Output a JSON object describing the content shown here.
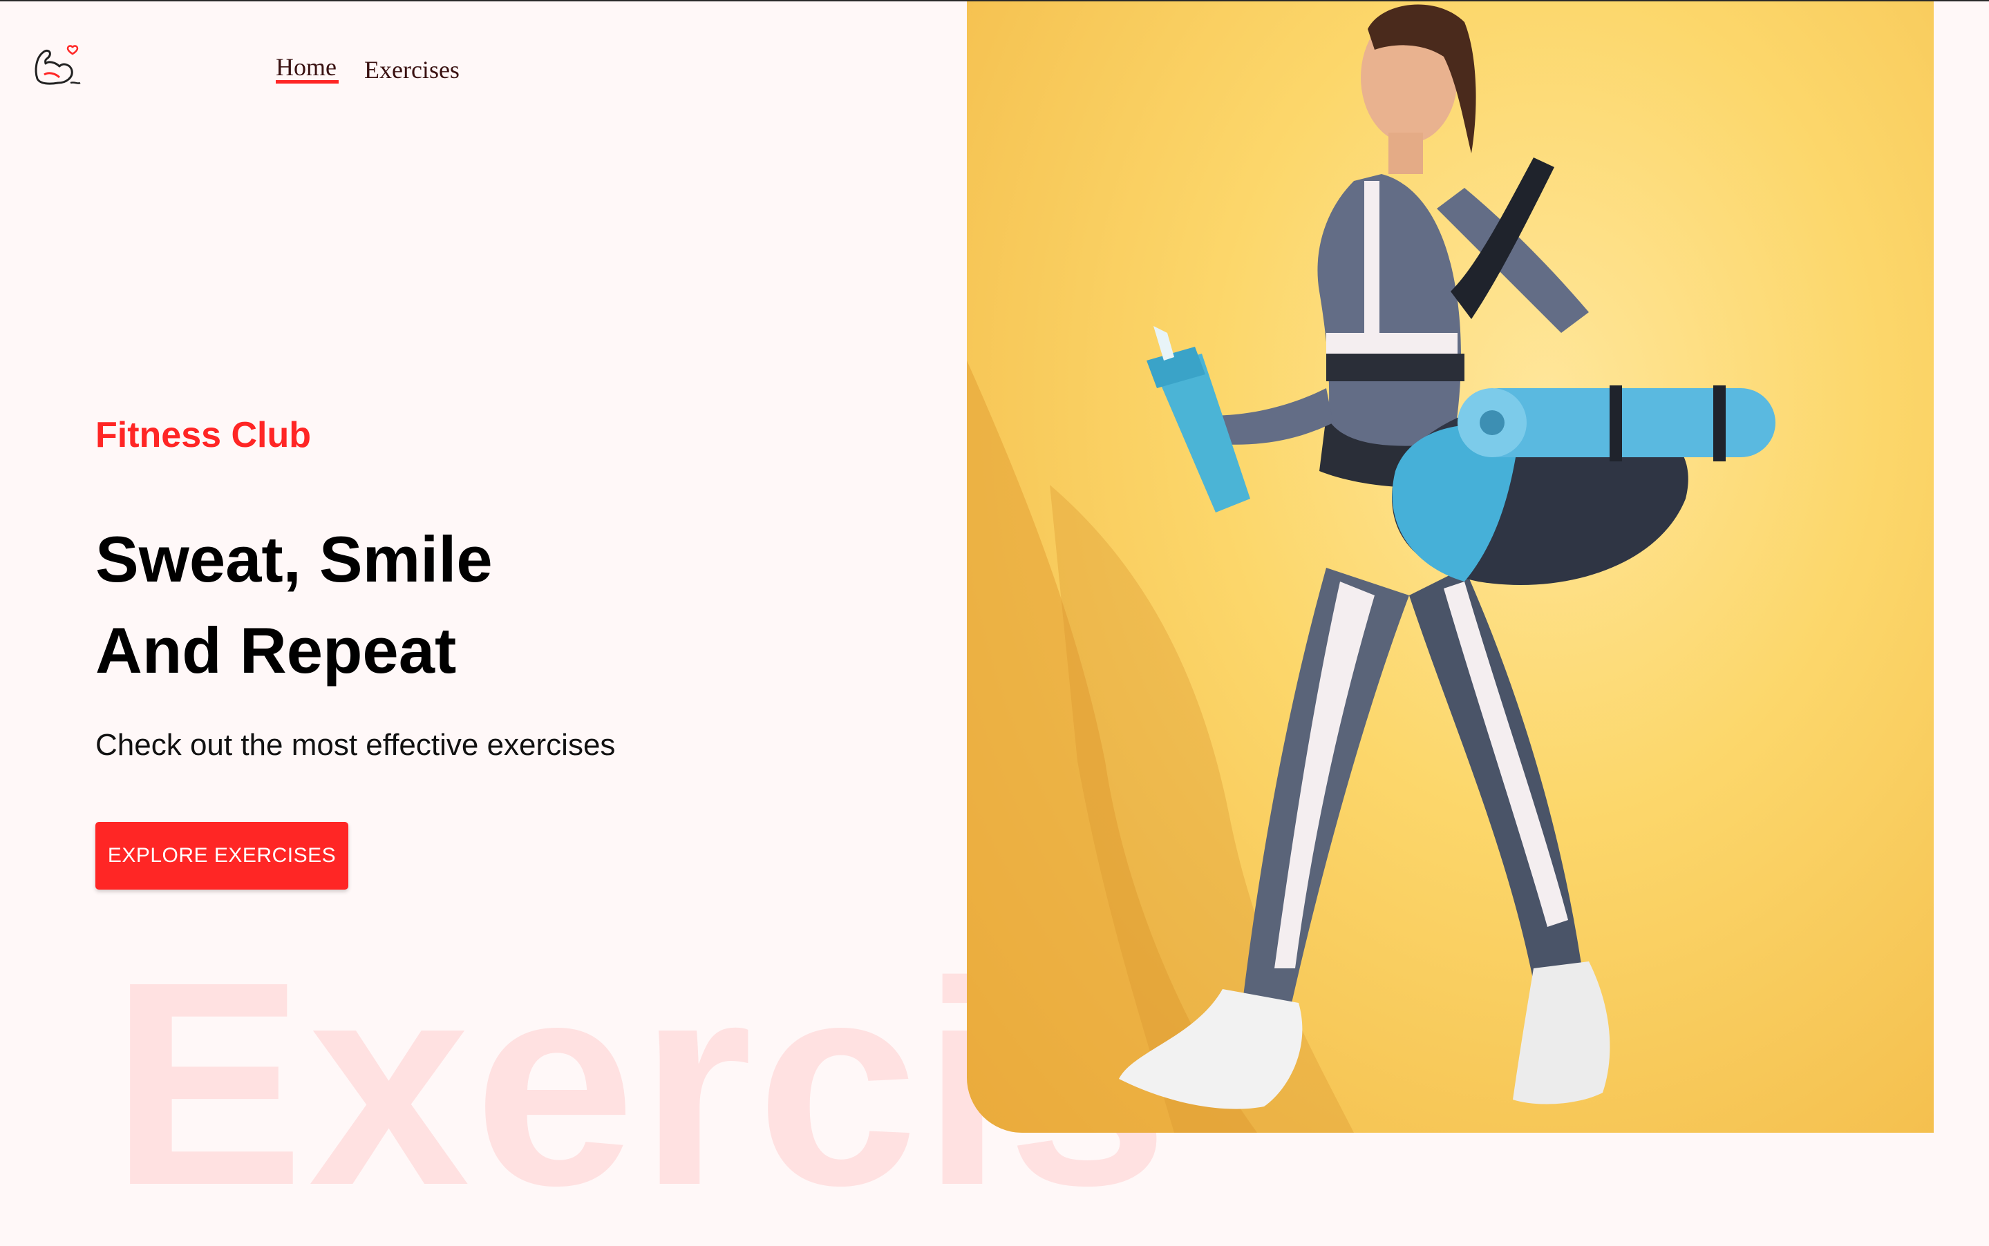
{
  "navbar": {
    "logo_icon": "flexed-arm-heart-icon",
    "links": [
      {
        "label": "Home",
        "active": true
      },
      {
        "label": "Exercises",
        "active": false
      }
    ]
  },
  "hero": {
    "subtitle": "Fitness Club",
    "title_line1": "Sweat, Smile",
    "title_line2": "And Repeat",
    "description": "Check out the most effective exercises",
    "button_label": "EXPLORE EXERCISES",
    "watermark": "Exercis"
  },
  "banner": {
    "image": "woman-walking-with-yoga-mat-and-shaker"
  },
  "colors": {
    "accent": "#ff2625",
    "background": "#fff8f8",
    "banner_background": "#fcd76b"
  }
}
